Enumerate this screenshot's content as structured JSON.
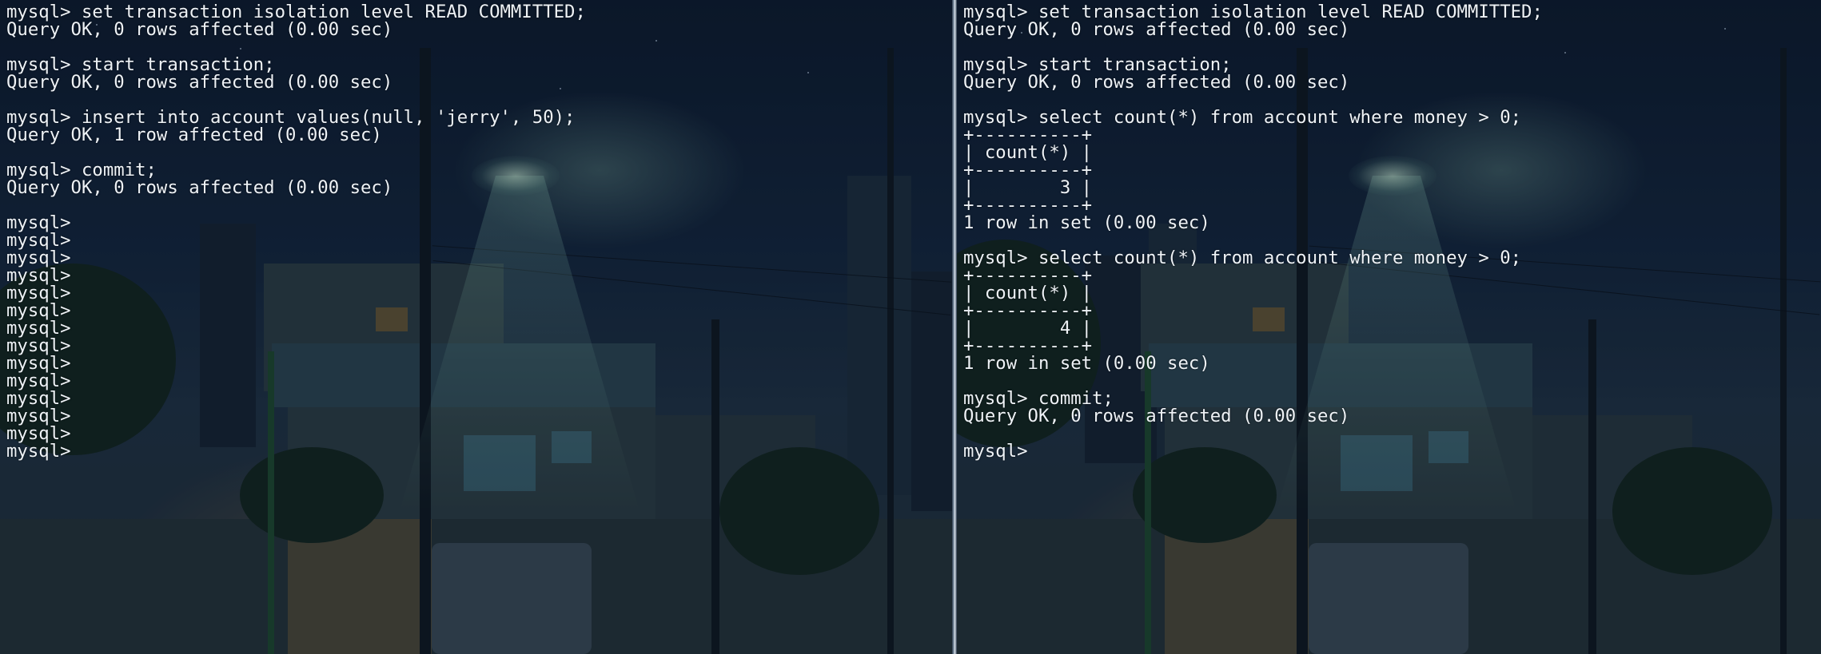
{
  "left_pane": {
    "lines": [
      "mysql> set transaction isolation level READ COMMITTED;",
      "Query OK, 0 rows affected (0.00 sec)",
      "",
      "mysql> start transaction;",
      "Query OK, 0 rows affected (0.00 sec)",
      "",
      "mysql> insert into account values(null, 'jerry', 50);",
      "Query OK, 1 row affected (0.00 sec)",
      "",
      "mysql> commit;",
      "Query OK, 0 rows affected (0.00 sec)",
      "",
      "mysql>",
      "mysql>",
      "mysql>",
      "mysql>",
      "mysql>",
      "mysql>",
      "mysql>",
      "mysql>",
      "mysql>",
      "mysql>",
      "mysql>",
      "mysql>",
      "mysql>",
      "mysql>"
    ]
  },
  "right_pane": {
    "lines": [
      "mysql> set transaction isolation level READ COMMITTED;",
      "Query OK, 0 rows affected (0.00 sec)",
      "",
      "mysql> start transaction;",
      "Query OK, 0 rows affected (0.00 sec)",
      "",
      "mysql> select count(*) from account where money > 0;",
      "+----------+",
      "| count(*) |",
      "+----------+",
      "|        3 |",
      "+----------+",
      "1 row in set (0.00 sec)",
      "",
      "mysql> select count(*) from account where money > 0;",
      "+----------+",
      "| count(*) |",
      "+----------+",
      "|        4 |",
      "+----------+",
      "1 row in set (0.00 sec)",
      "",
      "mysql> commit;",
      "Query OK, 0 rows affected (0.00 sec)",
      "",
      "mysql>"
    ]
  },
  "colors": {
    "text": "#eef2f6",
    "divider": "#dfe7ef",
    "background": "#13263d"
  }
}
